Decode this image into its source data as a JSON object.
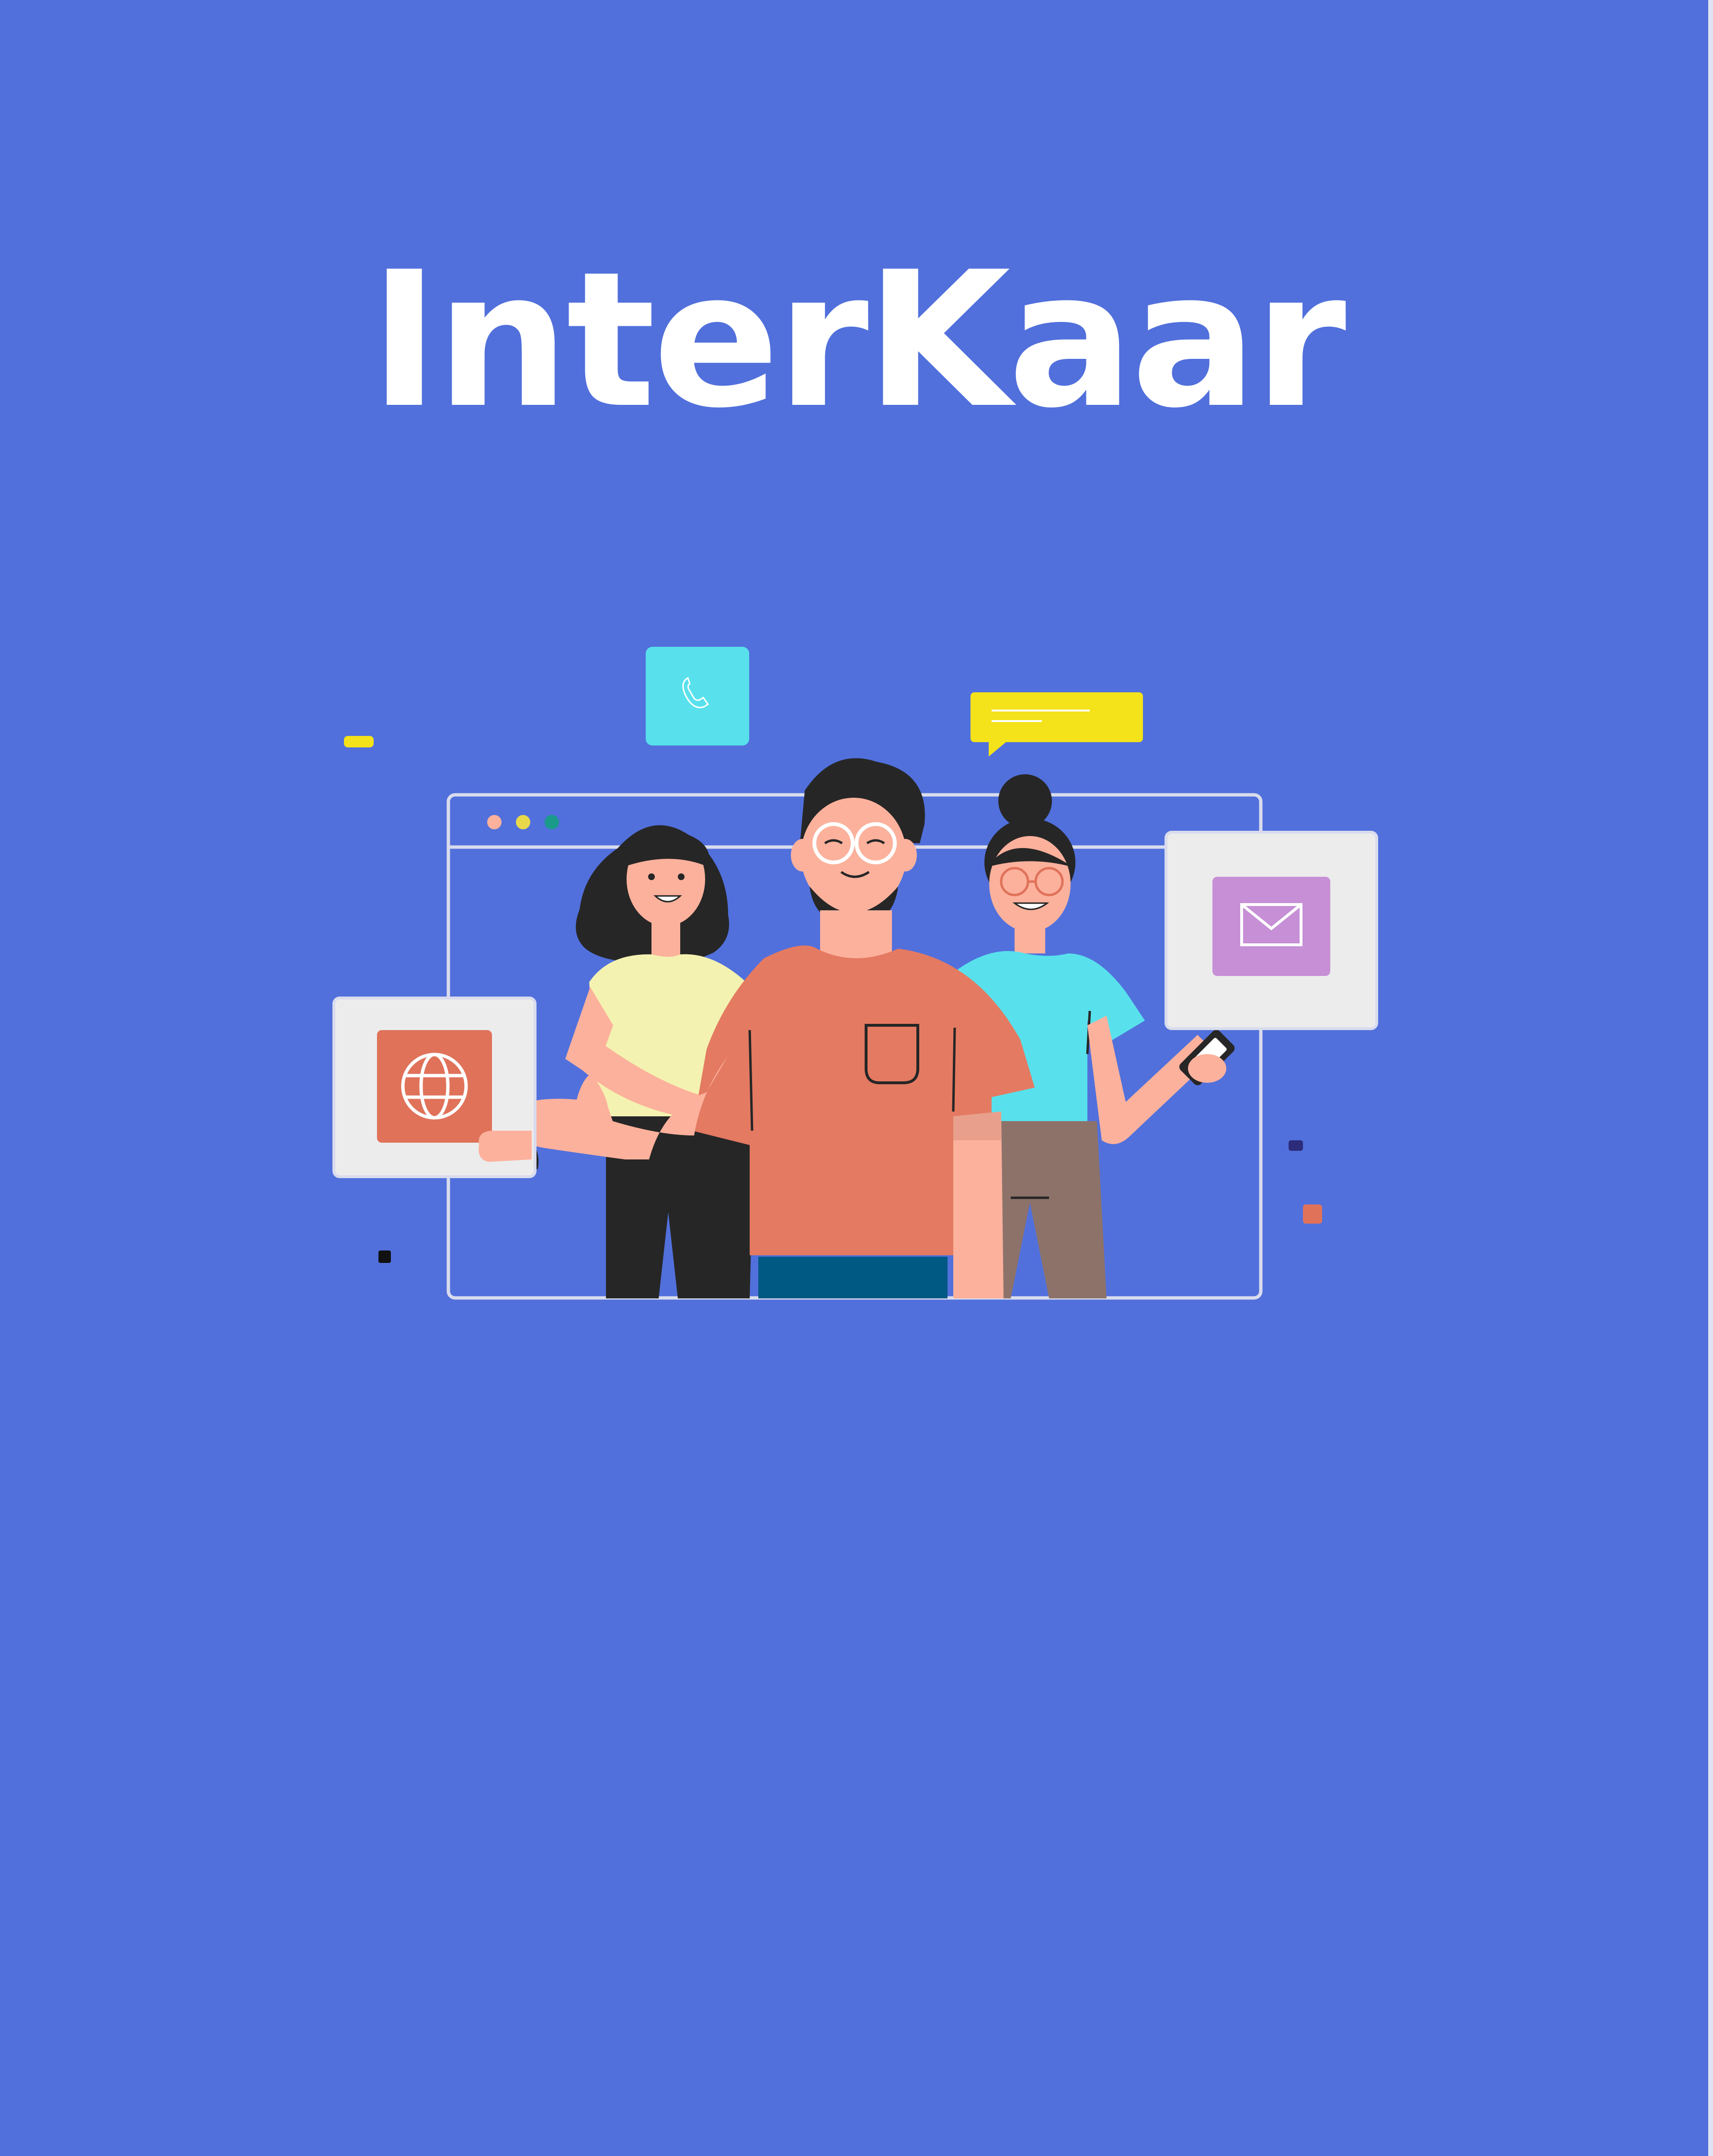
{
  "app": {
    "title": "InterKaar"
  },
  "colors": {
    "background": "#5170dc",
    "title_text": "#ffffff",
    "window_frame": "#d9dced",
    "orange_shirt": "#e47a62",
    "skin": "#fcb19c",
    "hair": "#262626",
    "yellow_top": "#f4f2b0",
    "cyan_top": "#58e1ec",
    "pants_brown": "#8d726a",
    "jeans_blue": "#005983",
    "card_bg": "#ececec",
    "globe_tile": "#e0725a",
    "mail_tile": "#c68fd6",
    "phone_tile": "#58e1ec",
    "chat_bubble": "#f4e21a"
  },
  "icons": [
    "phone-icon",
    "chat-bubble-icon",
    "globe-icon",
    "mail-icon",
    "smartphone-icon"
  ]
}
